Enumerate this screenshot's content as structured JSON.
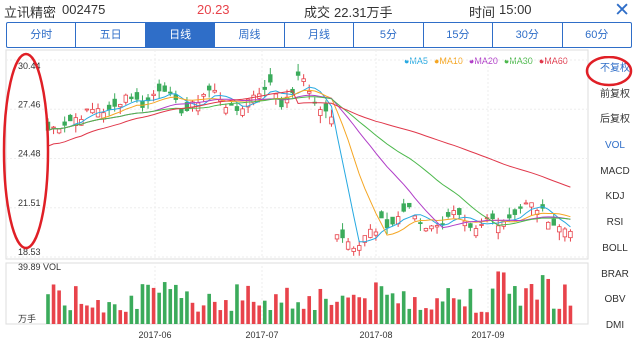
{
  "header": {
    "stock_name": "立讯精密",
    "stock_code": "002475",
    "price": "20.23",
    "volume_label": "成交",
    "volume": "22.31万手",
    "time_label": "时间",
    "time": "15:00",
    "close_icon": "close-icon"
  },
  "tabs": [
    "分时",
    "五日",
    "日线",
    "周线",
    "月线",
    "5分",
    "15分",
    "30分",
    "60分"
  ],
  "active_tab": "日线",
  "side_buttons": [
    "不复权",
    "前复权",
    "后复权",
    "VOL",
    "MACD",
    "KDJ",
    "RSI",
    "BOLL",
    "BRAR",
    "OBV",
    "DMI"
  ],
  "legend": [
    {
      "label": "MA5",
      "color": "#27a9e1"
    },
    {
      "label": "MA10",
      "color": "#f5a623"
    },
    {
      "label": "MA20",
      "color": "#b03ec8"
    },
    {
      "label": "MA30",
      "color": "#4cb84c"
    },
    {
      "label": "MA60",
      "color": "#e0384b"
    }
  ],
  "colors": {
    "up": "#e8434b",
    "down": "#3bab5b",
    "accent": "#2f6ec8",
    "highlight": "#e01f26"
  },
  "chart_data": {
    "type": "candlestick",
    "price_axis": [
      "30.44",
      "27.46",
      "24.48",
      "21.51",
      "18.53"
    ],
    "ylim": [
      18.53,
      30.44
    ],
    "volume_axis_max": "39.89",
    "volume_label": "VOL",
    "volume_unit": "万手",
    "x_ticks": [
      "2017-06",
      "2017-07",
      "2017-08",
      "2017-09"
    ]
  }
}
